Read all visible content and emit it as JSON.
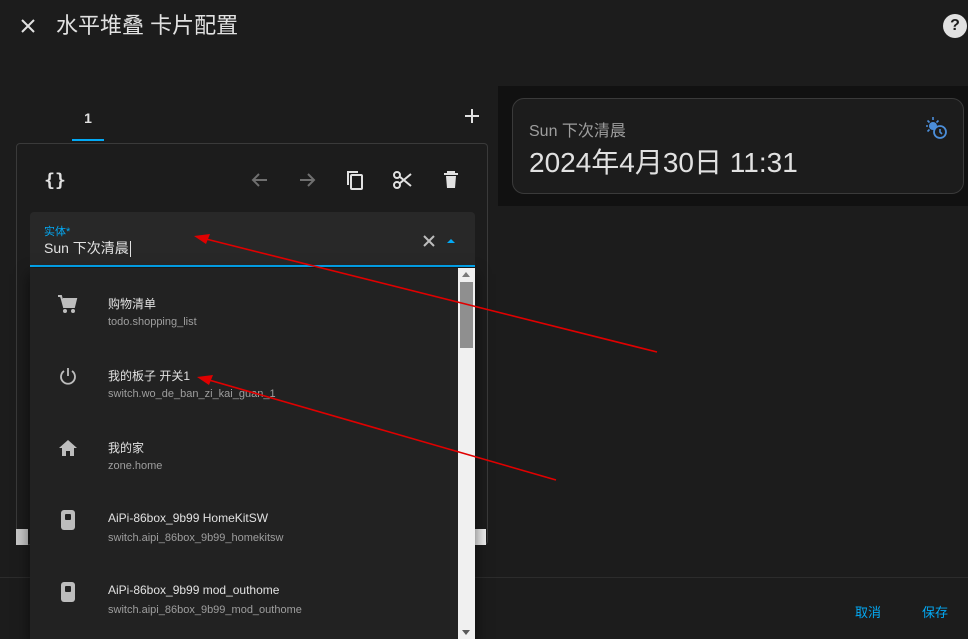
{
  "dialog": {
    "title": "水平堆叠 卡片配置",
    "help_label": "?"
  },
  "tabs": [
    {
      "label": "1"
    }
  ],
  "toolbar": {
    "code_label": "{}"
  },
  "entity_field": {
    "label": "实体*",
    "value": "Sun 下次清晨"
  },
  "dropdown_items": [
    {
      "title": "购物清单",
      "subtitle": "todo.shopping_list",
      "icon": "cart-icon"
    },
    {
      "title": "我的板子 开关1",
      "subtitle": "switch.wo_de_ban_zi_kai_guan_1",
      "icon": "power-icon"
    },
    {
      "title": "我的家",
      "subtitle": "zone.home",
      "icon": "home-icon"
    },
    {
      "title": "AiPi-86box_9b99 HomeKitSW",
      "subtitle": "switch.aipi_86box_9b99_homekitsw",
      "icon": "switch-device-icon"
    },
    {
      "title": "AiPi-86box_9b99 mod_outhome",
      "subtitle": "switch.aipi_86box_9b99_mod_outhome",
      "icon": "switch-device-icon"
    }
  ],
  "preview": {
    "name": "Sun 下次清晨",
    "value": "2024年4月30日 11:31",
    "icon": "sun-clock-icon"
  },
  "footer": {
    "cancel_label": "取消",
    "save_label": "保存"
  },
  "colors": {
    "accent": "#03a9f4",
    "background": "#1c1c1c",
    "annotation": "#e00000"
  }
}
